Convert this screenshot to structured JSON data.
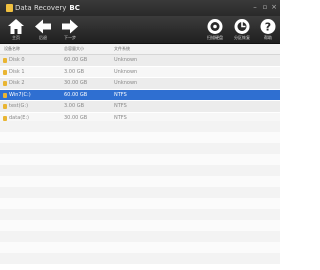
{
  "window": {
    "title": "Data Recovery",
    "brand": "BC"
  },
  "toolbar": {
    "home_label": "主页",
    "back_label": "后退",
    "next_label": "下一步",
    "btn_right1_label": "扫描硬盘",
    "btn_right2_label": "分区恢复",
    "help_label": "帮助"
  },
  "table": {
    "columns": [
      "设备名称",
      "总容量大小",
      "文件系统"
    ],
    "rows": [
      {
        "name": "Disk 0",
        "size": "60.00 GB",
        "fs": "Unknown"
      },
      {
        "name": "Disk 1",
        "size": "3.00 GB",
        "fs": "Unknown"
      },
      {
        "name": "Disk 2",
        "size": "30.00 GB",
        "fs": "Unknown"
      },
      {
        "name": "Win7(C:)",
        "size": "60.00 GB",
        "fs": "NTFS"
      },
      {
        "name": "test(G:)",
        "size": "3.00 GB",
        "fs": "NTFS"
      },
      {
        "name": "data(E:)",
        "size": "30.00 GB",
        "fs": "NTFS"
      }
    ]
  },
  "colors": {
    "selected_row": "#2f6fd1",
    "toolbar_bg": "#2a2a2a",
    "disk_icon": "#e9b532"
  }
}
